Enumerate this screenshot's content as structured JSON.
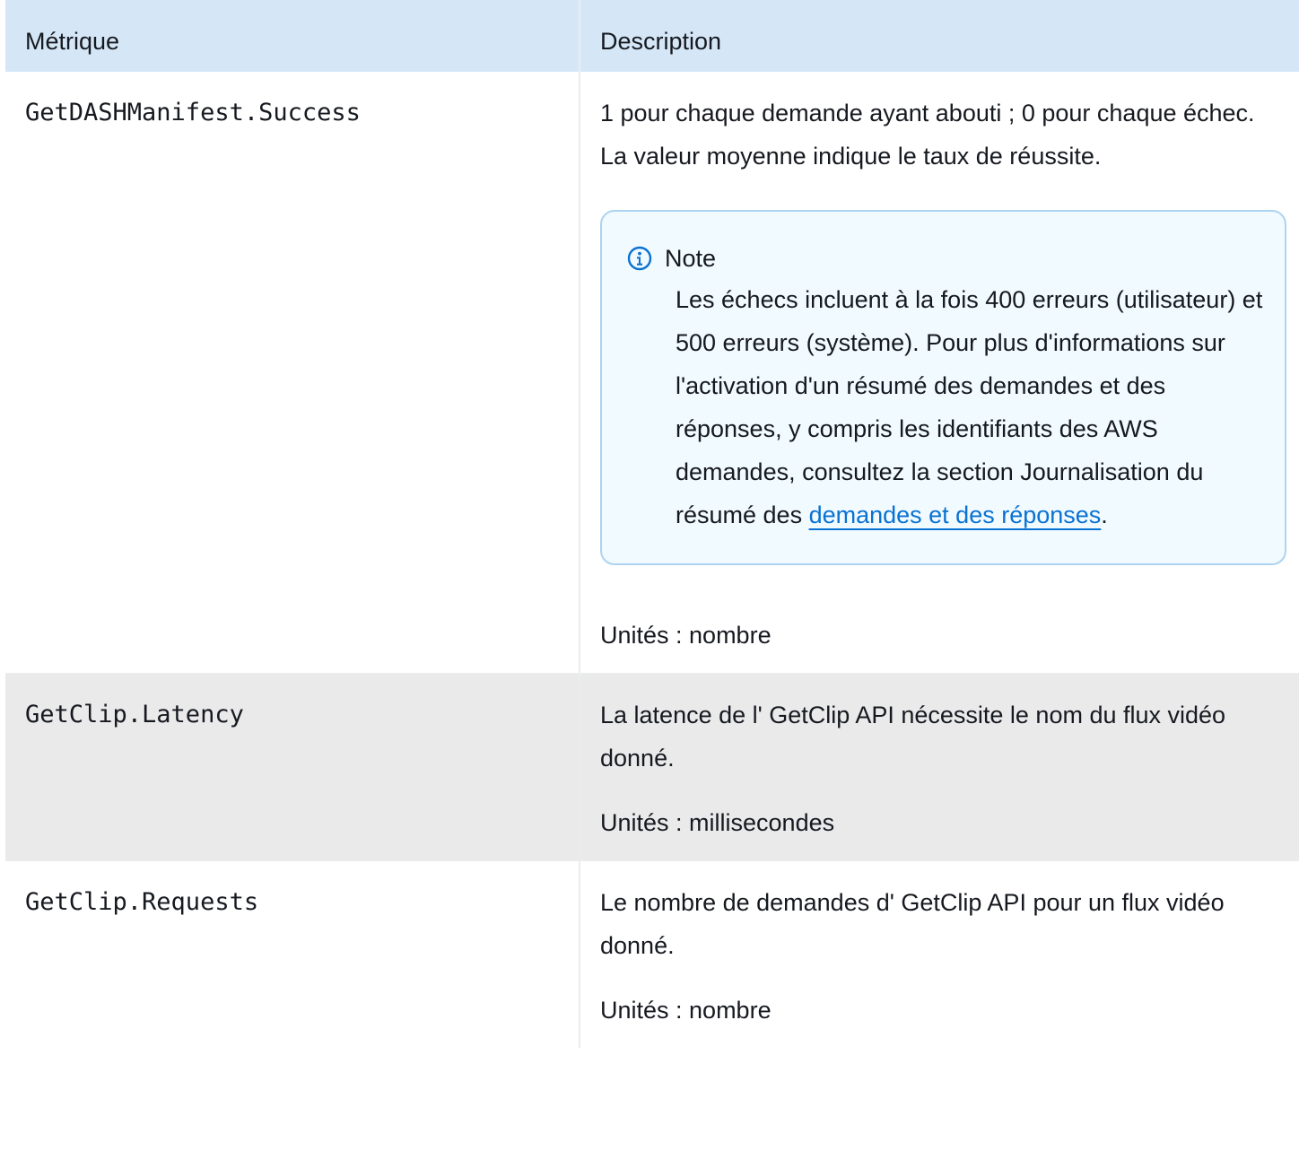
{
  "table": {
    "headers": {
      "metric": "Métrique",
      "description": "Description"
    },
    "rows": [
      {
        "metric": "GetDASHManifest.Success",
        "description": "1 pour chaque demande ayant abouti ; 0 pour chaque échec. La valeur moyenne indique le taux de réussite.",
        "note": {
          "title": "Note",
          "text_before": "Les échecs incluent à la fois 400 erreurs (utilisateur) et 500 erreurs (système). Pour plus d'informations sur l'activation d'un résumé des demandes et des réponses, y compris les identifiants des AWS demandes, consultez la section Journalisation du résumé des ",
          "link": "demandes et des réponses",
          "text_after": "."
        },
        "units": "Unités : nombre"
      },
      {
        "metric": "GetClip.Latency",
        "description": "La latence de l' GetClip API nécessite le nom du flux vidéo donné.",
        "units": "Unités : millisecondes"
      },
      {
        "metric": "GetClip.Requests",
        "description": "Le nombre de demandes d' GetClip API pour un flux vidéo donné.",
        "units": "Unités : nombre"
      }
    ]
  },
  "colors": {
    "header_bg": "#d5e7f7",
    "alt_row_bg": "#eaeaeb",
    "note_border": "#aed3f0",
    "note_bg": "#f1faff",
    "link": "#0972d3",
    "info_icon": "#0972d3"
  },
  "icons": {
    "note_icon": "info-icon"
  }
}
